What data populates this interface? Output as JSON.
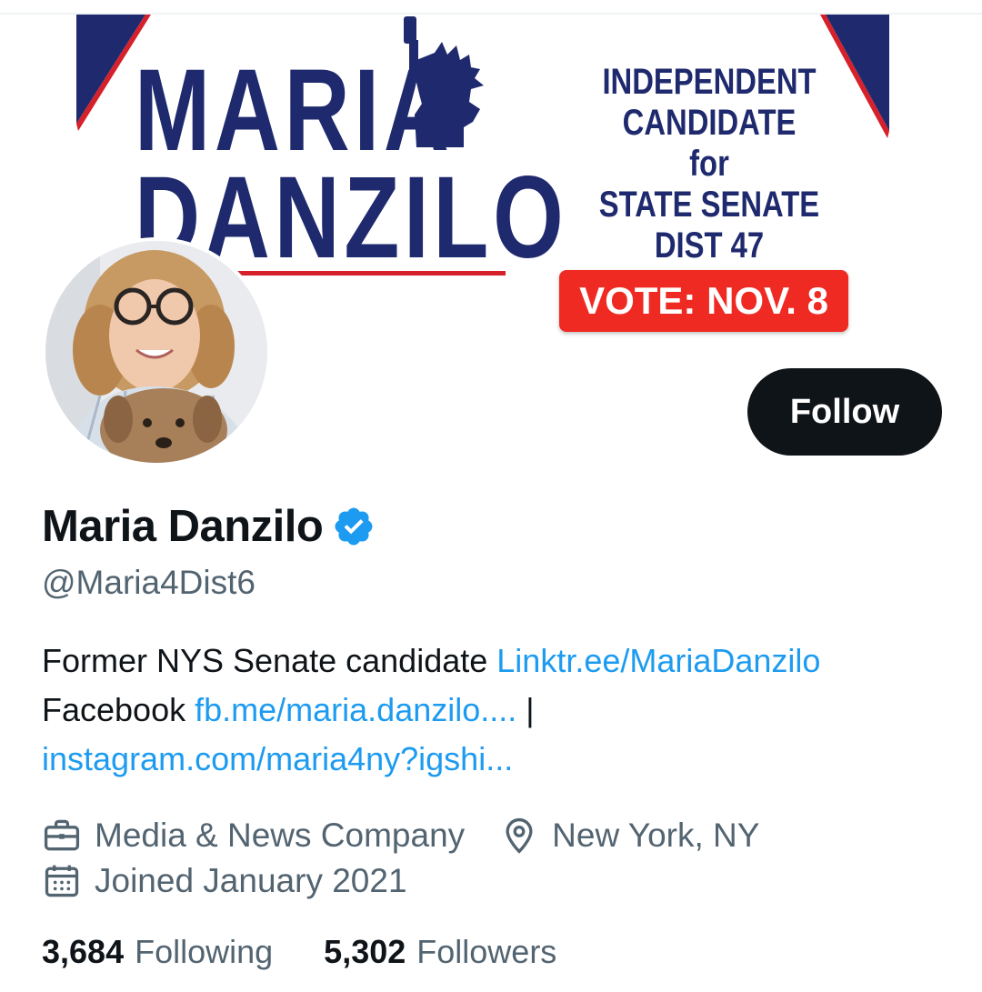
{
  "banner": {
    "name_first": "MARIA",
    "name_last": "DANZILO",
    "right_lines": [
      "INDEPENDENT",
      "CANDIDATE",
      "for",
      "STATE SENATE",
      "DIST 47"
    ],
    "vote_label": "VOTE: NOV. 8",
    "colors": {
      "navy": "#1f2a6e",
      "red": "#ef2a22",
      "flag_red": "#d6202a"
    }
  },
  "profile": {
    "display_name": "Maria Danzilo",
    "handle": "@Maria4Dist6",
    "verified": true,
    "follow_label": "Follow",
    "bio": {
      "line1_text": "Former NYS Senate candidate",
      "line1_link": "Linktr.ee/MariaDanzilo",
      "line2_text": "Facebook",
      "line2_link": "fb.me/maria.danzilo....",
      "line2_sep": "|",
      "line3_link": "instagram.com/maria4ny?igshi..."
    },
    "category": "Media & News Company",
    "location": "New York, NY",
    "joined": "Joined January 2021",
    "following_count": "3,684",
    "following_label": "Following",
    "followers_count": "5,302",
    "followers_label": "Followers"
  },
  "icons": {
    "category": "briefcase-icon",
    "location": "location-pin-icon",
    "joined": "calendar-icon",
    "verified": "verified-badge-icon"
  },
  "colors": {
    "link": "#1d9bf0",
    "secondary_text": "#536471",
    "primary_text": "#0f1419",
    "follow_bg": "#0f1419"
  }
}
